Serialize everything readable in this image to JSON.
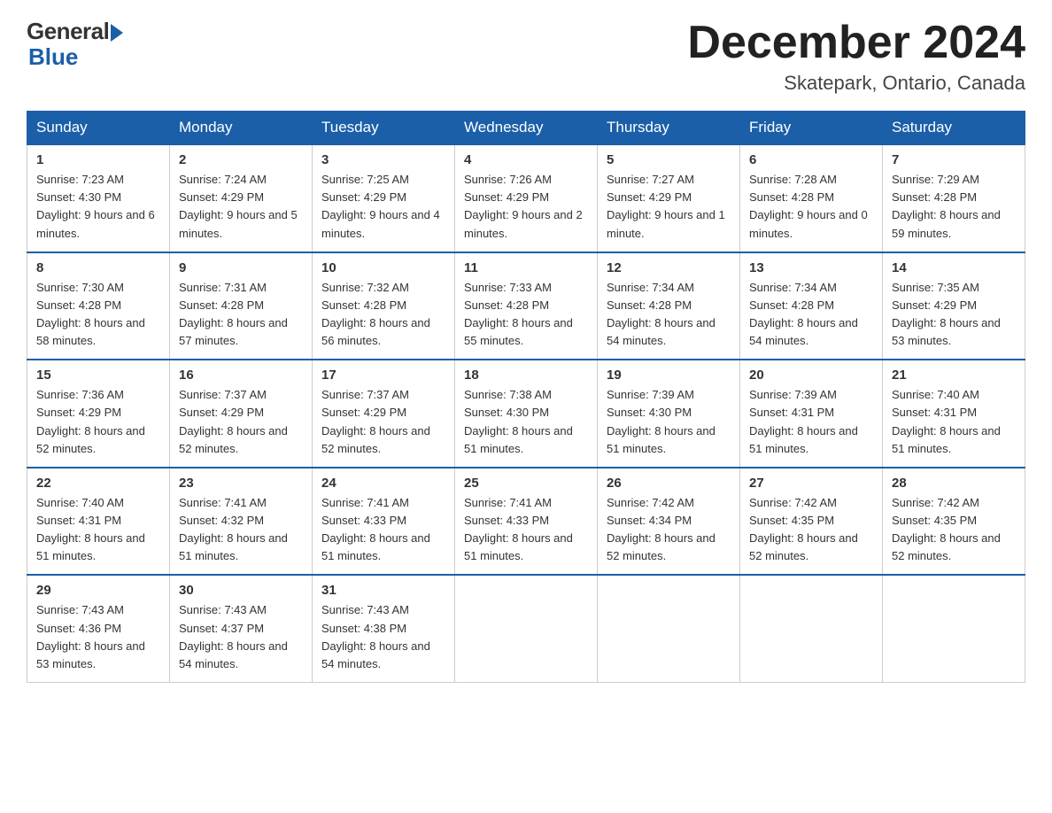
{
  "header": {
    "logo_general": "General",
    "logo_blue": "Blue",
    "title": "December 2024",
    "location": "Skatepark, Ontario, Canada"
  },
  "days_of_week": [
    "Sunday",
    "Monday",
    "Tuesday",
    "Wednesday",
    "Thursday",
    "Friday",
    "Saturday"
  ],
  "weeks": [
    [
      {
        "day": 1,
        "sunrise": "7:23 AM",
        "sunset": "4:30 PM",
        "daylight": "9 hours and 6 minutes."
      },
      {
        "day": 2,
        "sunrise": "7:24 AM",
        "sunset": "4:29 PM",
        "daylight": "9 hours and 5 minutes."
      },
      {
        "day": 3,
        "sunrise": "7:25 AM",
        "sunset": "4:29 PM",
        "daylight": "9 hours and 4 minutes."
      },
      {
        "day": 4,
        "sunrise": "7:26 AM",
        "sunset": "4:29 PM",
        "daylight": "9 hours and 2 minutes."
      },
      {
        "day": 5,
        "sunrise": "7:27 AM",
        "sunset": "4:29 PM",
        "daylight": "9 hours and 1 minute."
      },
      {
        "day": 6,
        "sunrise": "7:28 AM",
        "sunset": "4:28 PM",
        "daylight": "9 hours and 0 minutes."
      },
      {
        "day": 7,
        "sunrise": "7:29 AM",
        "sunset": "4:28 PM",
        "daylight": "8 hours and 59 minutes."
      }
    ],
    [
      {
        "day": 8,
        "sunrise": "7:30 AM",
        "sunset": "4:28 PM",
        "daylight": "8 hours and 58 minutes."
      },
      {
        "day": 9,
        "sunrise": "7:31 AM",
        "sunset": "4:28 PM",
        "daylight": "8 hours and 57 minutes."
      },
      {
        "day": 10,
        "sunrise": "7:32 AM",
        "sunset": "4:28 PM",
        "daylight": "8 hours and 56 minutes."
      },
      {
        "day": 11,
        "sunrise": "7:33 AM",
        "sunset": "4:28 PM",
        "daylight": "8 hours and 55 minutes."
      },
      {
        "day": 12,
        "sunrise": "7:34 AM",
        "sunset": "4:28 PM",
        "daylight": "8 hours and 54 minutes."
      },
      {
        "day": 13,
        "sunrise": "7:34 AM",
        "sunset": "4:28 PM",
        "daylight": "8 hours and 54 minutes."
      },
      {
        "day": 14,
        "sunrise": "7:35 AM",
        "sunset": "4:29 PM",
        "daylight": "8 hours and 53 minutes."
      }
    ],
    [
      {
        "day": 15,
        "sunrise": "7:36 AM",
        "sunset": "4:29 PM",
        "daylight": "8 hours and 52 minutes."
      },
      {
        "day": 16,
        "sunrise": "7:37 AM",
        "sunset": "4:29 PM",
        "daylight": "8 hours and 52 minutes."
      },
      {
        "day": 17,
        "sunrise": "7:37 AM",
        "sunset": "4:29 PM",
        "daylight": "8 hours and 52 minutes."
      },
      {
        "day": 18,
        "sunrise": "7:38 AM",
        "sunset": "4:30 PM",
        "daylight": "8 hours and 51 minutes."
      },
      {
        "day": 19,
        "sunrise": "7:39 AM",
        "sunset": "4:30 PM",
        "daylight": "8 hours and 51 minutes."
      },
      {
        "day": 20,
        "sunrise": "7:39 AM",
        "sunset": "4:31 PM",
        "daylight": "8 hours and 51 minutes."
      },
      {
        "day": 21,
        "sunrise": "7:40 AM",
        "sunset": "4:31 PM",
        "daylight": "8 hours and 51 minutes."
      }
    ],
    [
      {
        "day": 22,
        "sunrise": "7:40 AM",
        "sunset": "4:31 PM",
        "daylight": "8 hours and 51 minutes."
      },
      {
        "day": 23,
        "sunrise": "7:41 AM",
        "sunset": "4:32 PM",
        "daylight": "8 hours and 51 minutes."
      },
      {
        "day": 24,
        "sunrise": "7:41 AM",
        "sunset": "4:33 PM",
        "daylight": "8 hours and 51 minutes."
      },
      {
        "day": 25,
        "sunrise": "7:41 AM",
        "sunset": "4:33 PM",
        "daylight": "8 hours and 51 minutes."
      },
      {
        "day": 26,
        "sunrise": "7:42 AM",
        "sunset": "4:34 PM",
        "daylight": "8 hours and 52 minutes."
      },
      {
        "day": 27,
        "sunrise": "7:42 AM",
        "sunset": "4:35 PM",
        "daylight": "8 hours and 52 minutes."
      },
      {
        "day": 28,
        "sunrise": "7:42 AM",
        "sunset": "4:35 PM",
        "daylight": "8 hours and 52 minutes."
      }
    ],
    [
      {
        "day": 29,
        "sunrise": "7:43 AM",
        "sunset": "4:36 PM",
        "daylight": "8 hours and 53 minutes."
      },
      {
        "day": 30,
        "sunrise": "7:43 AM",
        "sunset": "4:37 PM",
        "daylight": "8 hours and 54 minutes."
      },
      {
        "day": 31,
        "sunrise": "7:43 AM",
        "sunset": "4:38 PM",
        "daylight": "8 hours and 54 minutes."
      },
      null,
      null,
      null,
      null
    ]
  ],
  "labels": {
    "sunrise": "Sunrise:",
    "sunset": "Sunset:",
    "daylight": "Daylight:"
  }
}
